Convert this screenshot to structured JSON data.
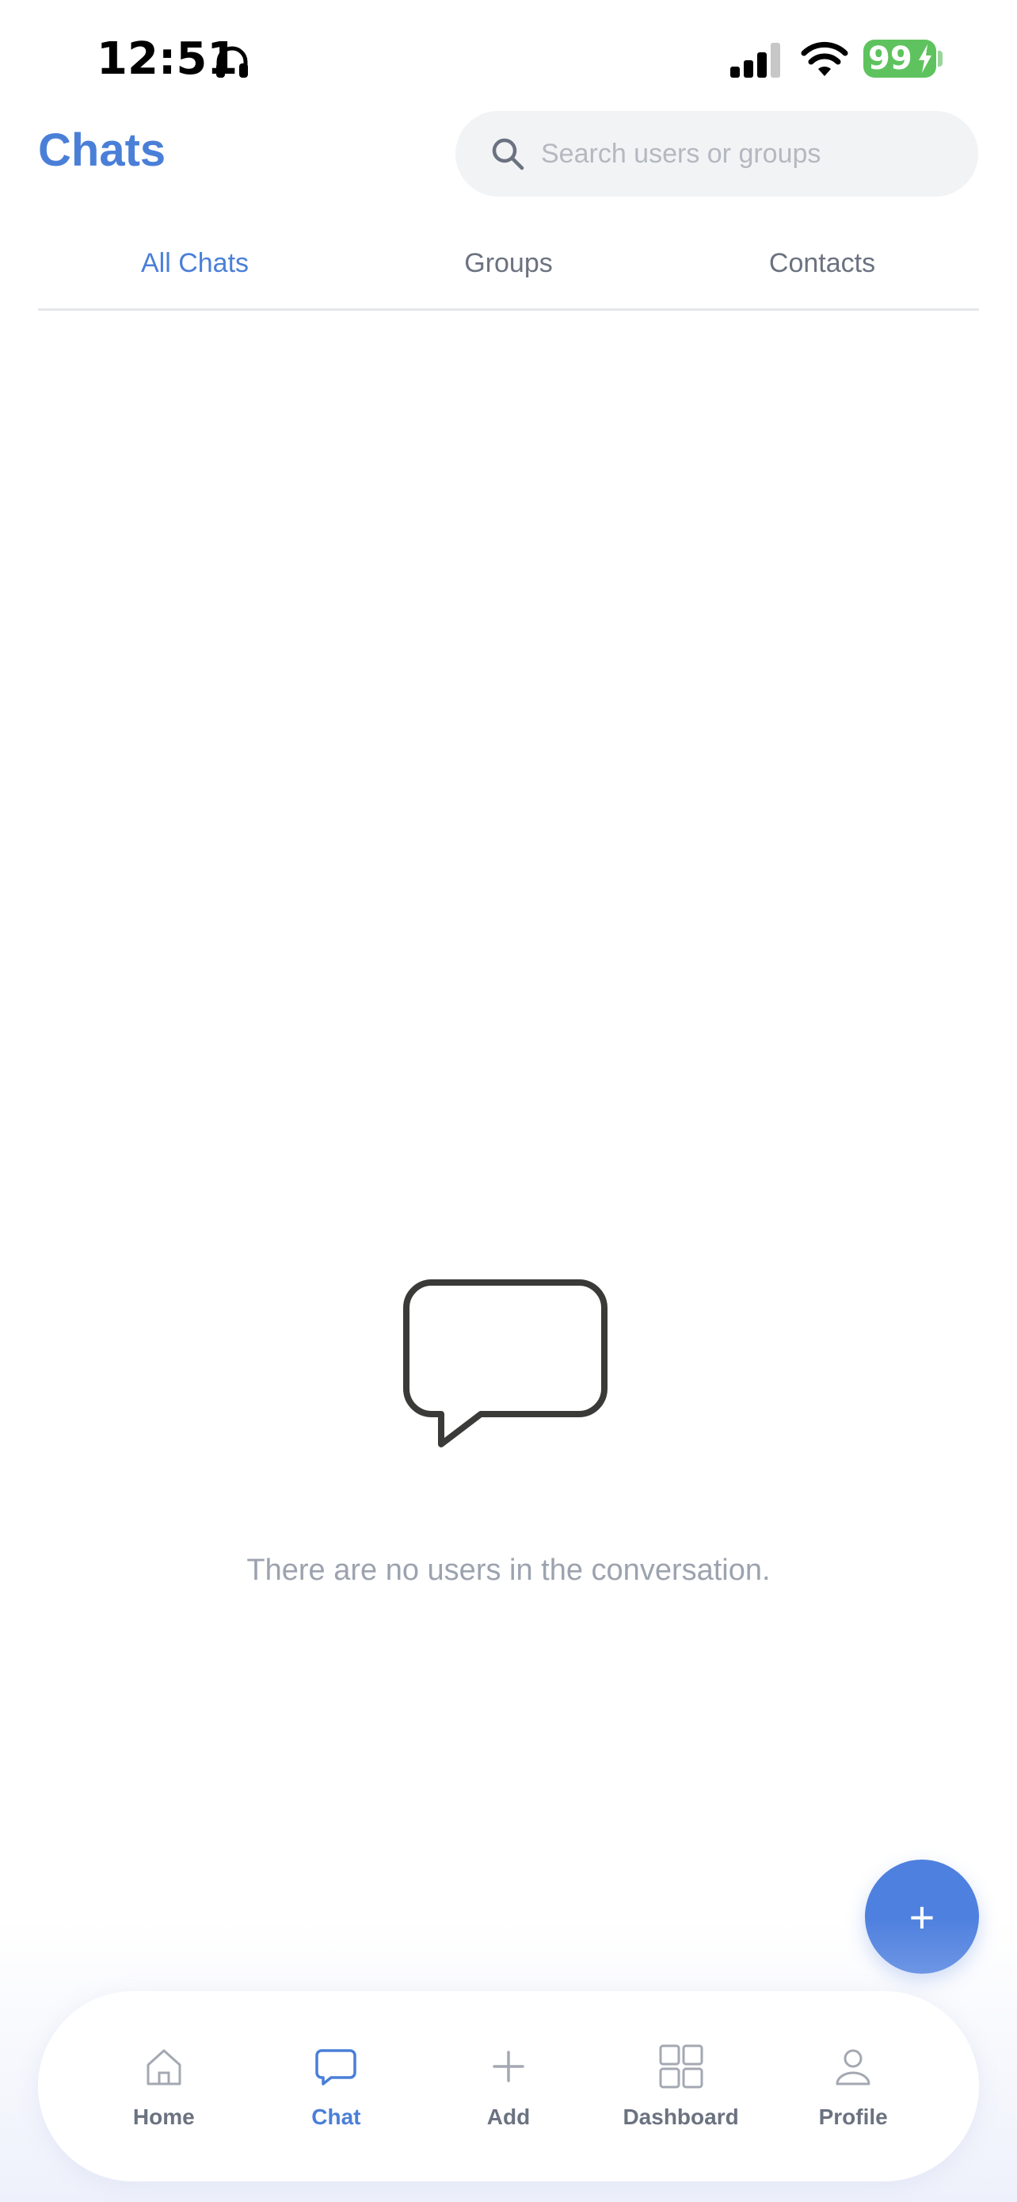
{
  "status_bar": {
    "time": "12:51",
    "battery": "99"
  },
  "header": {
    "title": "Chats"
  },
  "search": {
    "placeholder": "Search users or groups"
  },
  "tabs": [
    {
      "label": "All Chats",
      "active": true
    },
    {
      "label": "Groups",
      "active": false
    },
    {
      "label": "Contacts",
      "active": false
    }
  ],
  "empty_state": {
    "icon": "chat-bubble-icon",
    "message": "There are no users in the conversation."
  },
  "fab": {
    "label": "+",
    "icon": "plus-icon"
  },
  "bottom_nav": {
    "items": [
      {
        "label": "Home",
        "icon": "home-icon",
        "active": false
      },
      {
        "label": "Chat",
        "icon": "chat-icon",
        "active": true
      },
      {
        "label": "Add",
        "icon": "plus-icon",
        "active": false
      },
      {
        "label": "Dashboard",
        "icon": "grid-icon",
        "active": false
      },
      {
        "label": "Profile",
        "icon": "user-icon",
        "active": false
      }
    ]
  },
  "colors": {
    "accent": "#4a7fd8",
    "battery": "#5ec35e",
    "muted_text": "#9ca3af"
  }
}
